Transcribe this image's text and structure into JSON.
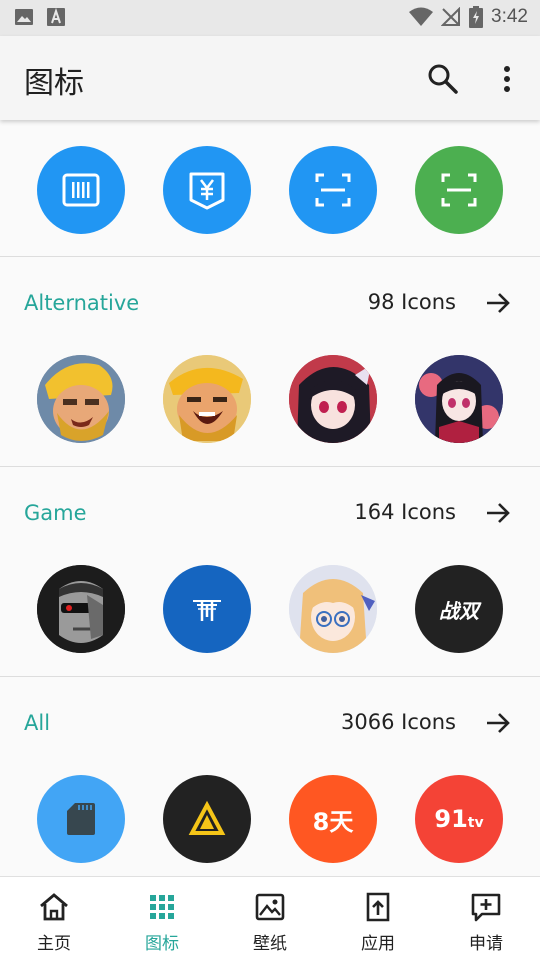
{
  "status_bar": {
    "time": "3:42"
  },
  "app_bar": {
    "title": "图标"
  },
  "sections": [
    {
      "title": "Alternative",
      "count": "98 Icons"
    },
    {
      "title": "Game",
      "count": "164 Icons"
    },
    {
      "title": "All",
      "count": "3066 Icons"
    }
  ],
  "icon_text": {
    "zhanshuang": "战双",
    "eight_days": "8天",
    "nine_one": "91",
    "tv": "tv"
  },
  "bottom_nav": [
    {
      "label": "主页"
    },
    {
      "label": "图标"
    },
    {
      "label": "壁纸"
    },
    {
      "label": "应用"
    },
    {
      "label": "申请"
    }
  ],
  "colors": {
    "accent": "#26a69a",
    "blue_icon": "#2196f3",
    "green_icon": "#4caf50",
    "red_icon": "#f44336",
    "orange_icon": "#ff5722",
    "dark_icon": "#222222"
  }
}
